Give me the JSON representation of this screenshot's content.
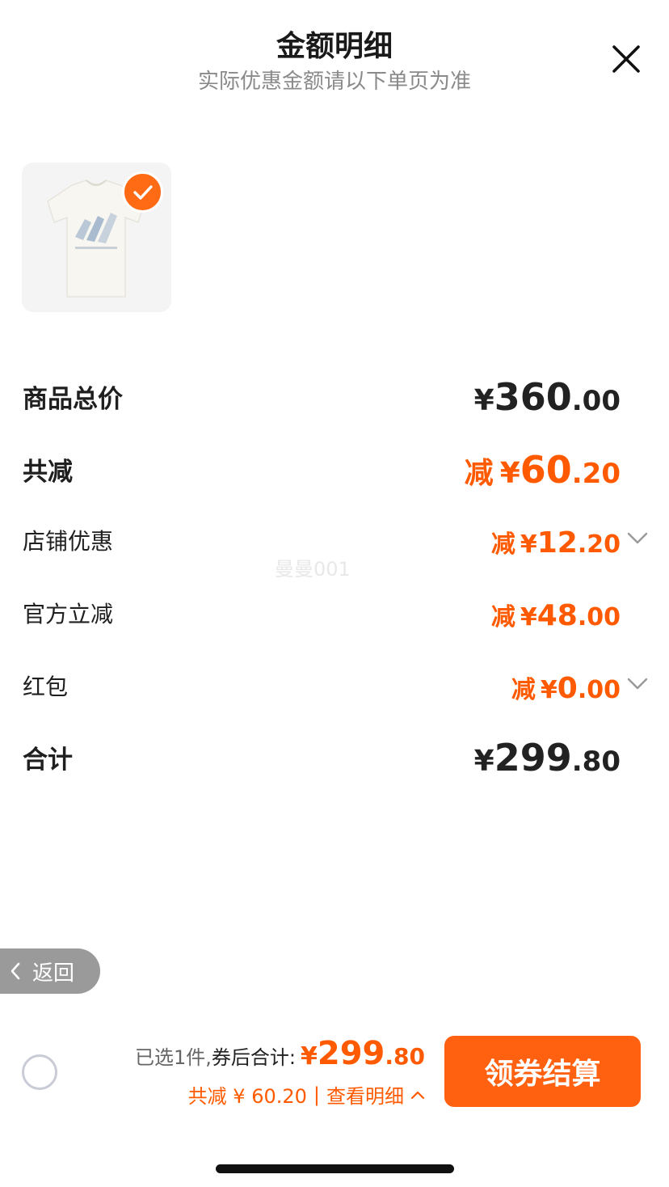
{
  "header": {
    "title": "金额明细",
    "subtitle": "实际优惠金额请以下单页为准",
    "close_icon": "close-icon"
  },
  "product": {
    "image_desc": "white t-shirt",
    "selected": true,
    "check_icon": "checkmark-icon"
  },
  "rows": {
    "total_price": {
      "label": "商品总价",
      "yen": "¥",
      "integer": "360",
      "decimal": ".00"
    },
    "total_reduce": {
      "label": "共减",
      "prefix": "减",
      "yen": "¥",
      "integer": "60",
      "decimal": ".20"
    },
    "shop_discount": {
      "label": "店铺优惠",
      "prefix": "减",
      "yen": "¥",
      "integer": "12",
      "decimal": ".20",
      "expand_icon": "chevron-down-icon"
    },
    "official_reduce": {
      "label": "官方立减",
      "prefix": "减",
      "yen": "¥",
      "integer": "48",
      "decimal": ".00"
    },
    "red_packet": {
      "label": "红包",
      "prefix": "减",
      "yen": "¥",
      "integer": "0",
      "decimal": ".00",
      "expand_icon": "chevron-down-icon"
    },
    "grand_total": {
      "label": "合计",
      "yen": "¥",
      "integer": "299",
      "decimal": ".80"
    }
  },
  "watermark": "曼曼001",
  "back_button": {
    "label": "返回",
    "icon": "chevron-left-icon"
  },
  "bottom_bar": {
    "selected_text": "已选1件,",
    "after_coupon_label": "券后合计:",
    "yen": "¥",
    "integer": "299",
    "decimal": ".80",
    "reduce_text": "共减 ¥ 60.20",
    "separator": "|",
    "view_detail": "查看明细",
    "view_detail_icon": "chevron-up-icon",
    "checkout_label": "领券结算"
  },
  "colors": {
    "accent": "#ff5a00",
    "button": "#ff6110",
    "text": "#222222",
    "muted": "#8a8a8a"
  }
}
